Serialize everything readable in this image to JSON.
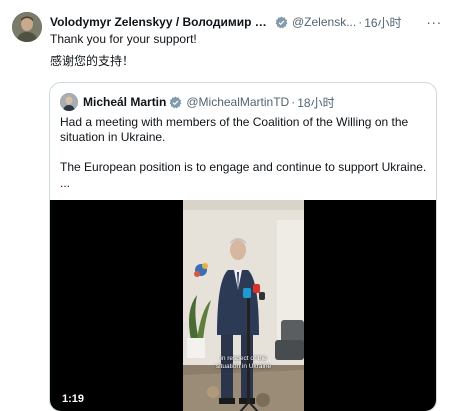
{
  "author": {
    "name": "Volodymyr Zelenskyy / Володимир Зел...",
    "handle": "@Zelensk...",
    "time": "16小时",
    "more_label": "···"
  },
  "tweet": {
    "line1": "Thank you for your support!",
    "line2": "感谢您的支持！"
  },
  "quoted": {
    "name": "Micheál Martin",
    "handle": "@MichealMartinTD",
    "time": "18小时",
    "para1": "Had a meeting with members of the Coalition of the Willing on the situation in Ukraine.",
    "para2": "The European position is to engage and continue to support Ukraine.",
    "ellipsis": "...",
    "video": {
      "duration": "1:19",
      "caption_line1": "in respect of the",
      "caption_line2": "situation in Ukraine"
    }
  },
  "colors": {
    "verified_badge": "#829aab",
    "border": "#cfd9de",
    "secondary_text": "#536471"
  },
  "icons": {
    "verified": "verified-badge-icon",
    "more": "more-icon"
  }
}
